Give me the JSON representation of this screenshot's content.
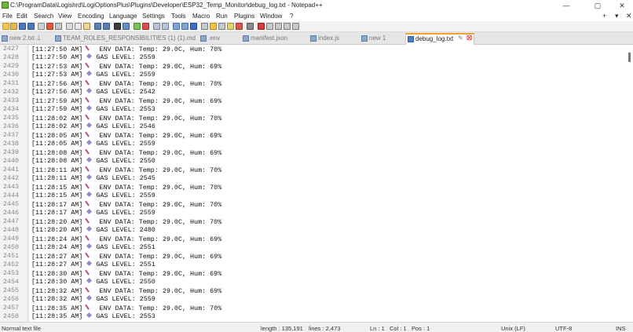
{
  "window": {
    "title": "C:\\ProgramData\\Logishrd\\LogiOptionsPlus\\Plugins\\Developer\\ESP32_Temp_Monitor\\debug_log.txt - Notepad++",
    "controls": {
      "minimize": "—",
      "maximize": "▢",
      "close": "✕"
    }
  },
  "menu": {
    "items": [
      "File",
      "Edit",
      "Search",
      "View",
      "Encoding",
      "Language",
      "Settings",
      "Tools",
      "Macro",
      "Run",
      "Plugins",
      "Window",
      "?"
    ],
    "right": [
      "+",
      "▾",
      "✕"
    ]
  },
  "tabs": [
    {
      "label": "new 2.txt",
      "active": false
    },
    {
      "label": "TEAM_ROLES_RESPONSIBILITIES (1) (1).md",
      "active": false
    },
    {
      "label": ".env",
      "active": false
    },
    {
      "label": "manifest.json",
      "active": false
    },
    {
      "label": "index.js",
      "active": false
    },
    {
      "label": "new 1",
      "active": false
    },
    {
      "label": "debug_log.txt",
      "active": true
    }
  ],
  "editor": {
    "lines": [
      {
        "num": "2427",
        "ts": "[11:27:50 AM]",
        "type": "env",
        "text": "ENV DATA: Temp: 29.0C, Hum: 70%"
      },
      {
        "num": "2428",
        "ts": "[11:27:50 AM]",
        "type": "gas",
        "text": "GAS LEVEL: 2559"
      },
      {
        "num": "2429",
        "ts": "[11:27:53 AM]",
        "type": "env",
        "text": "ENV DATA: Temp: 29.0C, Hum: 69%"
      },
      {
        "num": "2430",
        "ts": "[11:27:53 AM]",
        "type": "gas",
        "text": "GAS LEVEL: 2559"
      },
      {
        "num": "2431",
        "ts": "[11:27:56 AM]",
        "type": "env",
        "text": "ENV DATA: Temp: 29.0C, Hum: 70%"
      },
      {
        "num": "2432",
        "ts": "[11:27:56 AM]",
        "type": "gas",
        "text": "GAS LEVEL: 2542"
      },
      {
        "num": "2433",
        "ts": "[11:27:59 AM]",
        "type": "env",
        "text": "ENV DATA: Temp: 29.0C, Hum: 69%"
      },
      {
        "num": "2434",
        "ts": "[11:27:59 AM]",
        "type": "gas",
        "text": "GAS LEVEL: 2553"
      },
      {
        "num": "2435",
        "ts": "[11:28:02 AM]",
        "type": "env",
        "text": "ENV DATA: Temp: 29.0C, Hum: 70%"
      },
      {
        "num": "2436",
        "ts": "[11:28:02 AM]",
        "type": "gas",
        "text": "GAS LEVEL: 2546"
      },
      {
        "num": "2437",
        "ts": "[11:28:05 AM]",
        "type": "env",
        "text": "ENV DATA: Temp: 29.0C, Hum: 69%"
      },
      {
        "num": "2438",
        "ts": "[11:28:05 AM]",
        "type": "gas",
        "text": "GAS LEVEL: 2559"
      },
      {
        "num": "2439",
        "ts": "[11:28:08 AM]",
        "type": "env",
        "text": "ENV DATA: Temp: 29.0C, Hum: 69%"
      },
      {
        "num": "2440",
        "ts": "[11:28:08 AM]",
        "type": "gas",
        "text": "GAS LEVEL: 2550"
      },
      {
        "num": "2441",
        "ts": "[11:28:11 AM]",
        "type": "env",
        "text": "ENV DATA: Temp: 29.0C, Hum: 70%"
      },
      {
        "num": "2442",
        "ts": "[11:28:11 AM]",
        "type": "gas",
        "text": "GAS LEVEL: 2545"
      },
      {
        "num": "2443",
        "ts": "[11:28:15 AM]",
        "type": "env",
        "text": "ENV DATA: Temp: 29.0C, Hum: 70%"
      },
      {
        "num": "2444",
        "ts": "[11:28:15 AM]",
        "type": "gas",
        "text": "GAS LEVEL: 2559"
      },
      {
        "num": "2445",
        "ts": "[11:28:17 AM]",
        "type": "env",
        "text": "ENV DATA: Temp: 29.0C, Hum: 70%"
      },
      {
        "num": "2446",
        "ts": "[11:28:17 AM]",
        "type": "gas",
        "text": "GAS LEVEL: 2559"
      },
      {
        "num": "2447",
        "ts": "[11:28:20 AM]",
        "type": "env",
        "text": "ENV DATA: Temp: 29.0C, Hum: 70%"
      },
      {
        "num": "2448",
        "ts": "[11:28:20 AM]",
        "type": "gas",
        "text": "GAS LEVEL: 2480"
      },
      {
        "num": "2449",
        "ts": "[11:28:24 AM]",
        "type": "env",
        "text": "ENV DATA: Temp: 29.0C, Hum: 69%"
      },
      {
        "num": "2450",
        "ts": "[11:28:24 AM]",
        "type": "gas",
        "text": "GAS LEVEL: 2551"
      },
      {
        "num": "2451",
        "ts": "[11:28:27 AM]",
        "type": "env",
        "text": "ENV DATA: Temp: 29.0C, Hum: 69%"
      },
      {
        "num": "2452",
        "ts": "[11:28:27 AM]",
        "type": "gas",
        "text": "GAS LEVEL: 2551"
      },
      {
        "num": "2453",
        "ts": "[11:28:30 AM]",
        "type": "env",
        "text": "ENV DATA: Temp: 29.0C, Hum: 69%"
      },
      {
        "num": "2454",
        "ts": "[11:28:30 AM]",
        "type": "gas",
        "text": "GAS LEVEL: 2550"
      },
      {
        "num": "2455",
        "ts": "[11:28:32 AM]",
        "type": "env",
        "text": "ENV DATA: Temp: 29.0C, Hum: 69%"
      },
      {
        "num": "2456",
        "ts": "[11:28:32 AM]",
        "type": "gas",
        "text": "GAS LEVEL: 2559"
      },
      {
        "num": "2457",
        "ts": "[11:28:35 AM]",
        "type": "env",
        "text": "ENV DATA: Temp: 29.0C, Hum: 70%"
      },
      {
        "num": "2458",
        "ts": "[11:28:35 AM]",
        "type": "gas",
        "text": "GAS LEVEL: 2553"
      }
    ]
  },
  "status": {
    "file_type": "Normal text file",
    "length": "length : 135,191",
    "lines": "lines : 2,473",
    "ln": "Ln : 1",
    "col": "Col : 1",
    "pos": "Pos : 1",
    "eol": "Unix (LF)",
    "encoding": "UTF-8",
    "mode": "INS"
  },
  "colors": {
    "active_tab_accent": "#f3a22b",
    "env_icon": "#b44a94",
    "gas_icon": "#9a88c9"
  }
}
